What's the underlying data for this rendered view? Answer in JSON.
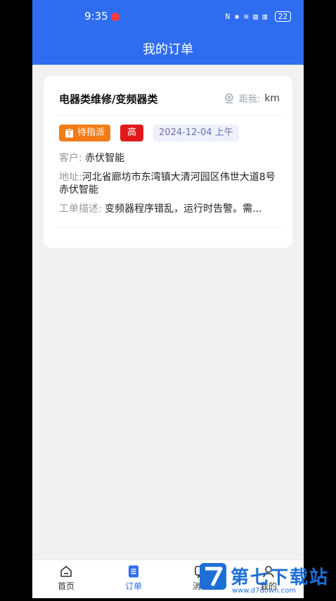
{
  "status_bar": {
    "time": "9:35",
    "icons": "N ✱ ≋ ▥ ▥",
    "battery": "22"
  },
  "header": {
    "title": "我的订单"
  },
  "order": {
    "title": "电器类维修/变频器类",
    "distance_label": "距我:",
    "distance_unit": "km",
    "status_tag": "待指派",
    "priority_tag": "高",
    "date_tag": "2024-12-04 上午",
    "customer_label": "客户:",
    "customer_value": "赤伏智能",
    "address_label": "地址:",
    "address_value": "河北省廊坊市东湾镇大清河园区伟世大道8号赤伏智能",
    "desc_label": "工单描述:",
    "desc_value": "变频器程序错乱，运行时告警。需..."
  },
  "tabs": [
    {
      "label": "首页",
      "icon": "home-icon"
    },
    {
      "label": "订单",
      "icon": "order-icon"
    },
    {
      "label": "消息",
      "icon": "message-icon"
    },
    {
      "label": "我的",
      "icon": "profile-icon"
    }
  ],
  "watermark": {
    "text": "第七下载站",
    "url": "www.d7down.com"
  },
  "colors": {
    "primary": "#2f6df0",
    "status_orange": "#f47b16",
    "priority_red": "#e01a1a",
    "background": "#f1f1f2"
  }
}
